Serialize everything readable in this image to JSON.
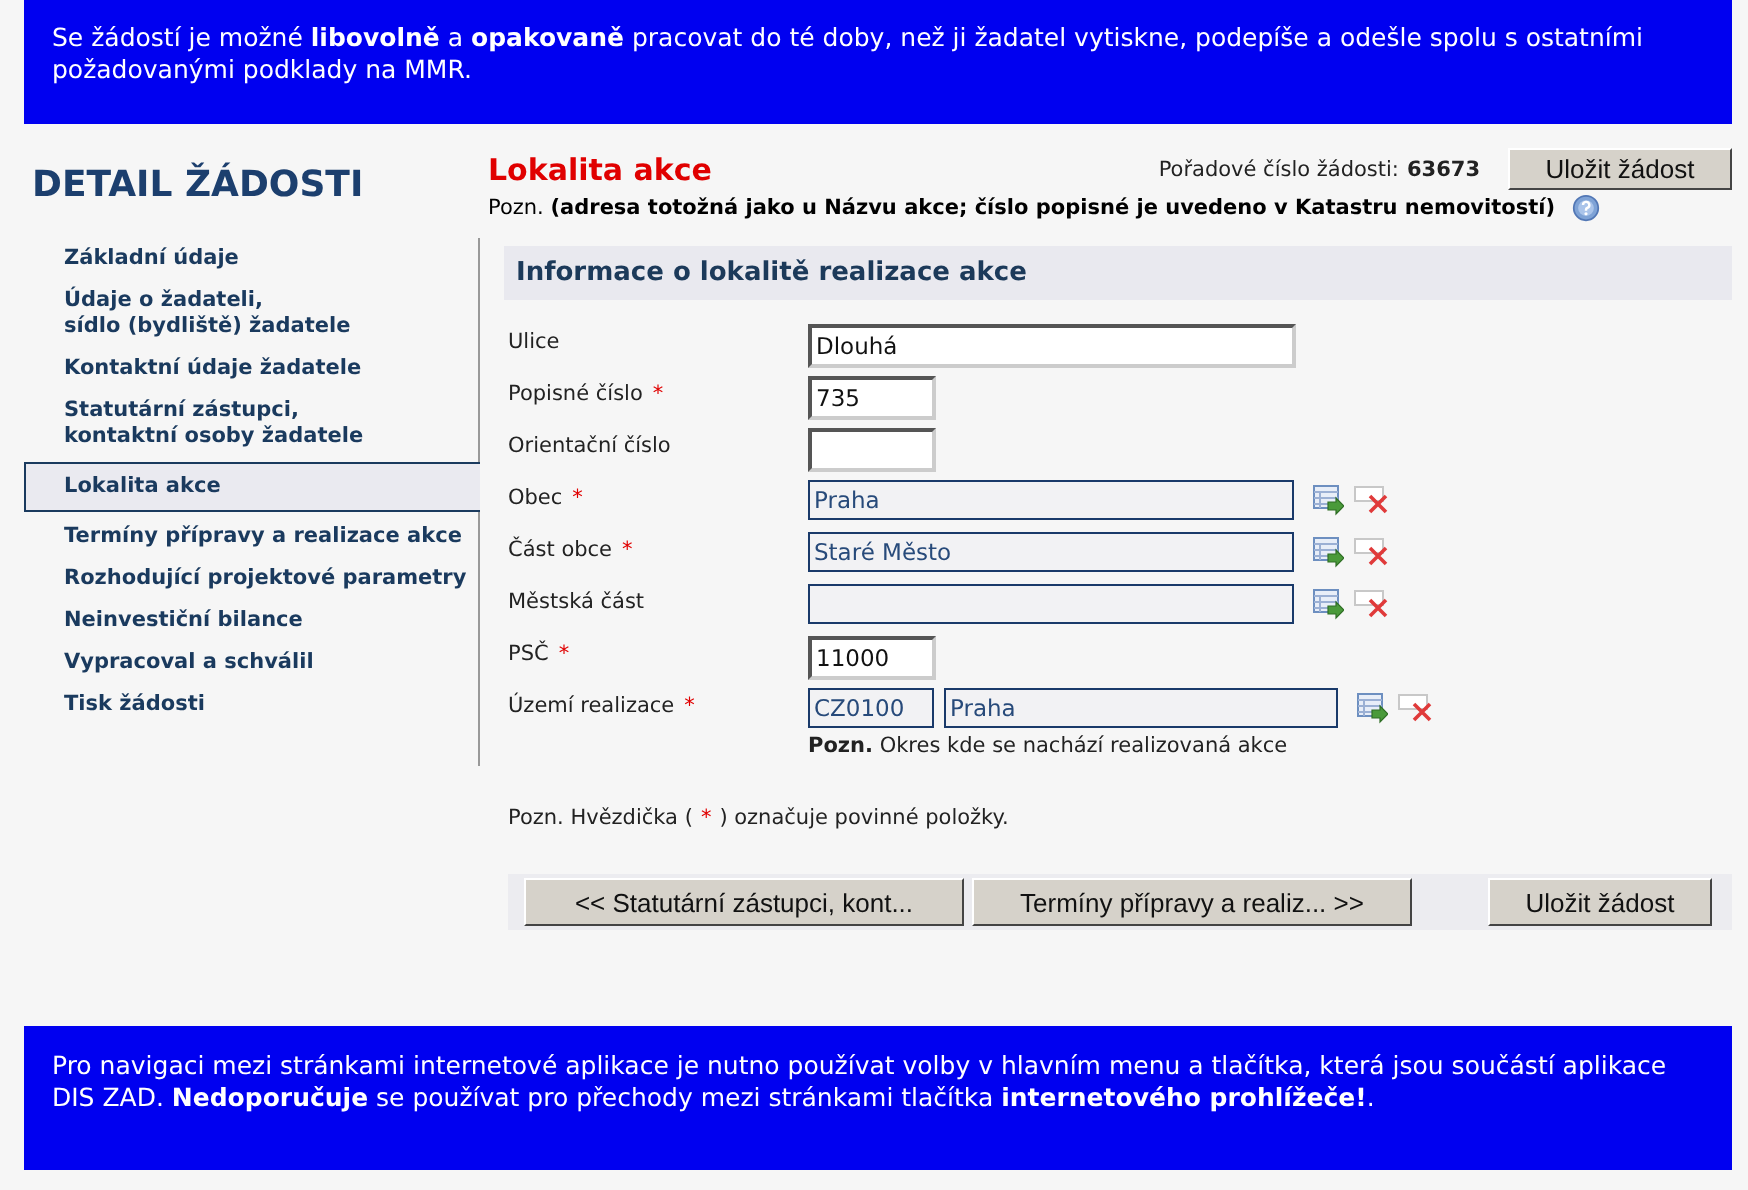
{
  "top_notice": "Se žádostí je možné **libovolně** a **opakovaně** pracovat do té doby, než ji žadatel vytiskne, podepíše a odešle spolu s ostatními požadovanými podklady na MMR.",
  "sidebar": {
    "title": "DETAIL ŽÁDOSTI",
    "items": [
      {
        "label": "Základní údaje",
        "selected": false
      },
      {
        "label": "Údaje o žadateli,\nsídlo (bydliště) žadatele",
        "selected": false
      },
      {
        "label": "Kontaktní údaje žadatele",
        "selected": false
      },
      {
        "label": "Statutární zástupci,\nkontaktní osoby žadatele",
        "selected": false
      },
      {
        "label": "Lokalita akce",
        "selected": true
      },
      {
        "label": "Termíny přípravy a realizace akce",
        "selected": false
      },
      {
        "label": "Rozhodující projektové parametry",
        "selected": false
      },
      {
        "label": "Neinvestiční bilance",
        "selected": false
      },
      {
        "label": "Vypracoval a schválil",
        "selected": false
      },
      {
        "label": "Tisk žádosti",
        "selected": false
      }
    ]
  },
  "page_title": "Lokalita akce",
  "order_number": {
    "label": "Pořadové číslo žádosti:",
    "value": "63673"
  },
  "save_button_top": "Uložit žádost",
  "note": "Pozn. **(adresa totožná jako u Názvu akce; číslo popisné je uvedeno v Katastru nemovitostí)**",
  "section_title": "Informace o lokalitě realizace akce",
  "fields": [
    {
      "label": "Ulice",
      "required": false,
      "kind": "text",
      "value": "Dlouhá"
    },
    {
      "label": "Popisné číslo",
      "required": true,
      "kind": "number",
      "value": "735"
    },
    {
      "label": "Orientační číslo",
      "required": false,
      "kind": "number"
    },
    {
      "label": "Obec",
      "required": true,
      "kind": "lookup",
      "values": [
        "Praha"
      ]
    },
    {
      "label": "Část obce",
      "required": true,
      "kind": "lookup",
      "values": [
        "Staré Město"
      ]
    },
    {
      "label": "Městská část",
      "required": false,
      "kind": "lookup"
    },
    {
      "label": "PSČ",
      "required": true,
      "kind": "number",
      "value": "11000"
    },
    {
      "label": "Území realizace",
      "required": true,
      "kind": "lookup",
      "values": [
        "CZ0100",
        "Praha"
      ],
      "hint": "**Pozn.** Okres kde se nachází realizovaná akce"
    }
  ],
  "required_note": {
    "before": "Pozn. Hvězdička (",
    "mark": "*",
    "after": ") označuje povinné položky."
  },
  "nav_buttons": {
    "prev": "<<  Statutární zástupci, kont...",
    "next": "Termíny přípravy a realiz...  >>",
    "save": "Uložit žádost"
  },
  "bottom_notice": "Pro navigaci mezi stránkami internetové aplikace je nutno používat volby v hlavním menu a tlačítka, která jsou součástí aplikace DIS ZAD. **Nedoporučuje** se používat pro přechody mezi stránkami tlačítka **internetového prohlížeče!**."
}
